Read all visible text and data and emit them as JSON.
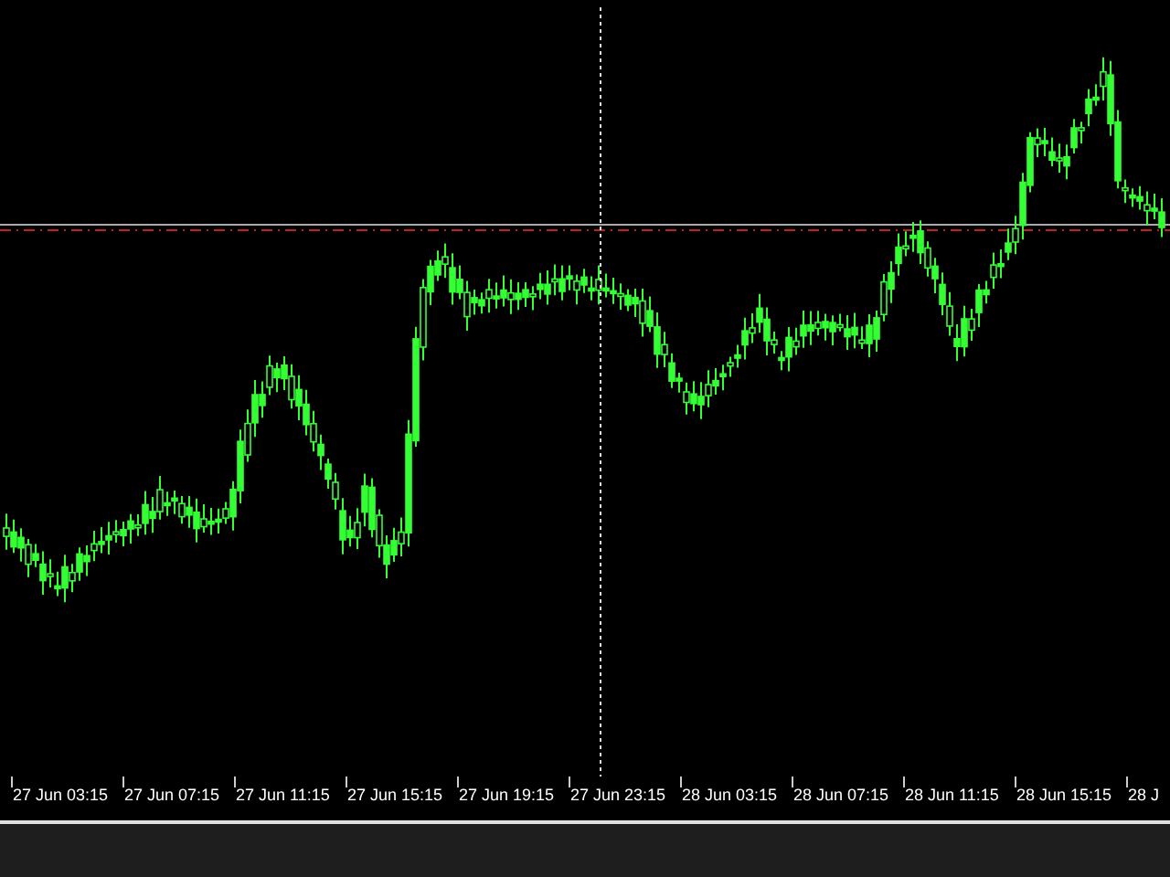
{
  "chart": {
    "time_labels": [
      "27 Jun 03:15",
      "27 Jun 07:15",
      "27 Jun 11:15",
      "27 Jun 15:15",
      "27 Jun 19:15",
      "27 Jun 23:15",
      "28 Jun 03:15",
      "28 Jun 07:15",
      "28 Jun 11:15",
      "28 Jun 15:15",
      "28 J"
    ]
  }
}
